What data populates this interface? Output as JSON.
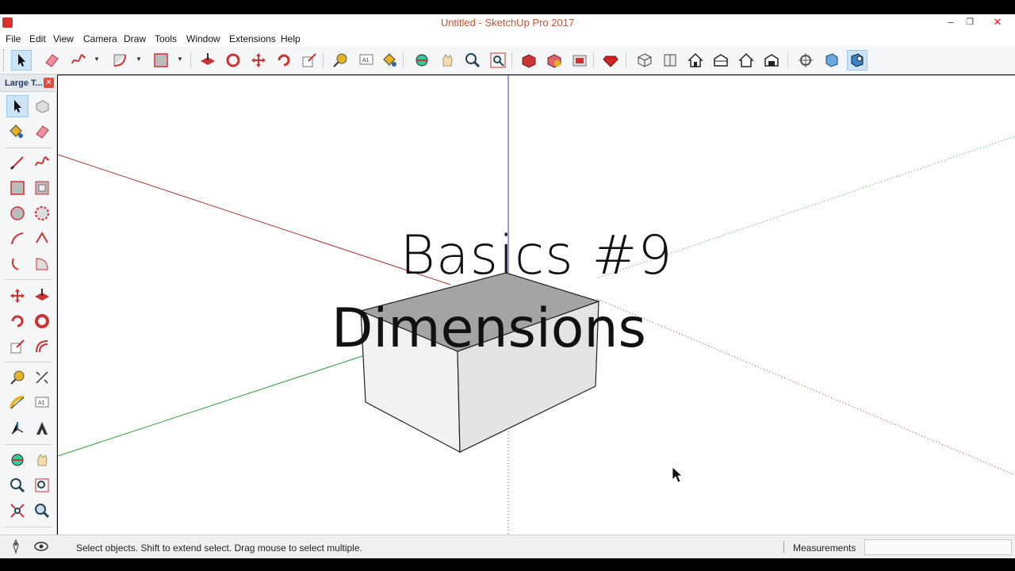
{
  "window": {
    "title": "Untitled - SketchUp Pro 2017",
    "min": "–",
    "max": "❐",
    "close": "✕"
  },
  "menu": [
    "File",
    "Edit",
    "View",
    "Camera",
    "Draw",
    "Tools",
    "Window",
    "Extensions",
    "Help"
  ],
  "panel": {
    "title": "Large T...",
    "close": "✕"
  },
  "overlay": {
    "line1": "Basics #9",
    "line2": "Dimensions"
  },
  "status": {
    "hint": "Select objects. Shift to extend select. Drag mouse to select multiple.",
    "measurements_label": "Measurements",
    "measurements_value": ""
  },
  "colors": {
    "red_axis": "#a8342f",
    "green_axis": "#2f9e3a",
    "blue_axis": "#3737c8",
    "box_top": "#a4a4a4",
    "box_side": "#ececec",
    "title_accent": "#c8532f"
  }
}
